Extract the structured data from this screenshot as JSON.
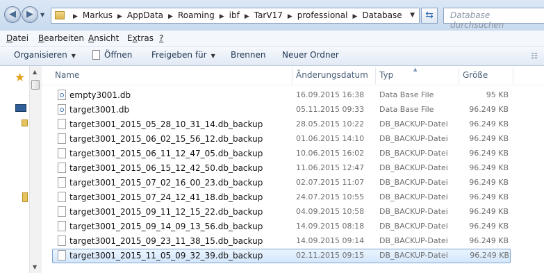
{
  "address": {
    "crumbs": [
      "Markus",
      "AppData",
      "Roaming",
      "ibf",
      "TarV17",
      "professional",
      "Database"
    ],
    "search_placeholder": "Database durchsuchen"
  },
  "menu": {
    "datei": "Datei",
    "bearbeiten": "Bearbeiten",
    "ansicht": "Ansicht",
    "extras": "Extras",
    "help": "?"
  },
  "commands": {
    "organize": "Organisieren",
    "open": "Öffnen",
    "share": "Freigeben für",
    "burn": "Brennen",
    "new_folder": "Neuer Ordner"
  },
  "columns": {
    "name": "Name",
    "date": "Änderungsdatum",
    "type": "Typ",
    "size": "Größe"
  },
  "files": [
    {
      "name": "empty3001.db",
      "date": "16.09.2015 16:38",
      "type": "Data Base File",
      "size": "95 KB",
      "icon": "database-file-icon"
    },
    {
      "name": "target3001.db",
      "date": "05.11.2015 09:33",
      "type": "Data Base File",
      "size": "96.249 KB",
      "icon": "database-file-icon"
    },
    {
      "name": "target3001_2015_05_28_10_31_14.db_backup",
      "date": "28.05.2015 10:22",
      "type": "DB_BACKUP-Datei",
      "size": "96.249 KB",
      "icon": "file-icon"
    },
    {
      "name": "target3001_2015_06_02_15_56_12.db_backup",
      "date": "01.06.2015 14:10",
      "type": "DB_BACKUP-Datei",
      "size": "96.249 KB",
      "icon": "file-icon"
    },
    {
      "name": "target3001_2015_06_11_12_47_05.db_backup",
      "date": "10.06.2015 16:02",
      "type": "DB_BACKUP-Datei",
      "size": "96.249 KB",
      "icon": "file-icon"
    },
    {
      "name": "target3001_2015_06_15_12_42_50.db_backup",
      "date": "11.06.2015 12:47",
      "type": "DB_BACKUP-Datei",
      "size": "96.249 KB",
      "icon": "file-icon"
    },
    {
      "name": "target3001_2015_07_02_16_00_23.db_backup",
      "date": "02.07.2015 11:07",
      "type": "DB_BACKUP-Datei",
      "size": "96.249 KB",
      "icon": "file-icon"
    },
    {
      "name": "target3001_2015_07_24_12_41_18.db_backup",
      "date": "24.07.2015 10:55",
      "type": "DB_BACKUP-Datei",
      "size": "96.249 KB",
      "icon": "file-icon"
    },
    {
      "name": "target3001_2015_09_11_12_15_22.db_backup",
      "date": "04.09.2015 10:58",
      "type": "DB_BACKUP-Datei",
      "size": "96.249 KB",
      "icon": "file-icon"
    },
    {
      "name": "target3001_2015_09_14_09_13_56.db_backup",
      "date": "14.09.2015 08:18",
      "type": "DB_BACKUP-Datei",
      "size": "96.249 KB",
      "icon": "file-icon"
    },
    {
      "name": "target3001_2015_09_23_11_38_15.db_backup",
      "date": "14.09.2015 09:14",
      "type": "DB_BACKUP-Datei",
      "size": "96.249 KB",
      "icon": "file-icon"
    },
    {
      "name": "target3001_2015_11_05_09_32_39.db_backup",
      "date": "02.11.2015 09:15",
      "type": "DB_BACKUP-Datei",
      "size": "96.249 KB",
      "icon": "file-icon",
      "selected": true
    }
  ],
  "colors": {
    "selection_border": "#7da2ce",
    "selection_fill": "#d3e7fc",
    "header_text": "#4c607a"
  }
}
